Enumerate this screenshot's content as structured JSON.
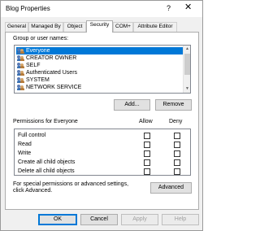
{
  "window": {
    "title": "Blog Properties",
    "help_glyph": "?",
    "close_glyph": "✕"
  },
  "tabs": [
    {
      "label": "General",
      "active": false
    },
    {
      "label": "Managed By",
      "active": false
    },
    {
      "label": "Object",
      "active": false
    },
    {
      "label": "Security",
      "active": true
    },
    {
      "label": "COM+",
      "active": false
    },
    {
      "label": "Attribute Editor",
      "active": false
    }
  ],
  "security": {
    "group_label": "Group or user names:",
    "principals": [
      {
        "name": "Everyone",
        "selected": true,
        "icon": "user-group-icon"
      },
      {
        "name": "CREATOR OWNER",
        "selected": false,
        "icon": "user-group-icon"
      },
      {
        "name": "SELF",
        "selected": false,
        "icon": "user-group-icon"
      },
      {
        "name": "Authenticated Users",
        "selected": false,
        "icon": "user-group-icon"
      },
      {
        "name": "SYSTEM",
        "selected": false,
        "icon": "user-group-icon"
      },
      {
        "name": "NETWORK SERVICE",
        "selected": false,
        "icon": "user-group-icon"
      }
    ],
    "add_label": "Add...",
    "remove_label": "Remove",
    "permissions_for": "Permissions for Everyone",
    "allow_header": "Allow",
    "deny_header": "Deny",
    "permissions": [
      {
        "name": "Full control",
        "allow": false,
        "deny": false
      },
      {
        "name": "Read",
        "allow": false,
        "deny": false
      },
      {
        "name": "Write",
        "allow": false,
        "deny": false
      },
      {
        "name": "Create all child objects",
        "allow": false,
        "deny": false
      },
      {
        "name": "Delete all child objects",
        "allow": false,
        "deny": false
      }
    ],
    "advanced_text": "For special permissions or advanced settings, click Advanced.",
    "advanced_label": "Advanced"
  },
  "footer": {
    "ok_label": "OK",
    "cancel_label": "Cancel",
    "apply_label": "Apply",
    "help_label": "Help"
  },
  "colors": {
    "selection": "#0078d7",
    "dialog_bg": "#f0f0f0"
  }
}
